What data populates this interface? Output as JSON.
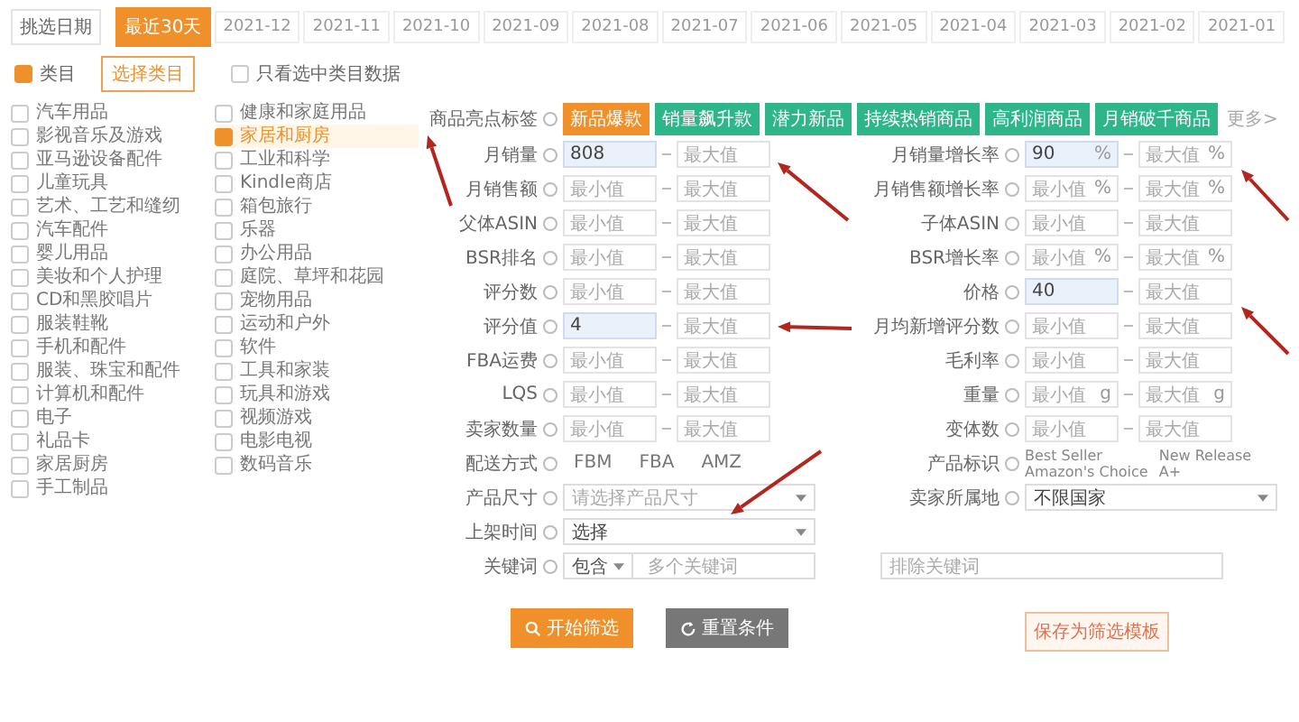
{
  "date_filter": {
    "label": "挑选日期",
    "options": [
      {
        "label": "最近30天",
        "selected": true
      },
      {
        "label": "2021-12",
        "selected": false
      },
      {
        "label": "2021-11",
        "selected": false
      },
      {
        "label": "2021-10",
        "selected": false
      },
      {
        "label": "2021-09",
        "selected": false
      },
      {
        "label": "2021-08",
        "selected": false
      },
      {
        "label": "2021-07",
        "selected": false
      },
      {
        "label": "2021-06",
        "selected": false
      },
      {
        "label": "2021-05",
        "selected": false
      },
      {
        "label": "2021-04",
        "selected": false
      },
      {
        "label": "2021-03",
        "selected": false
      },
      {
        "label": "2021-02",
        "selected": false
      },
      {
        "label": "2021-01",
        "selected": false
      }
    ]
  },
  "category_filter": {
    "checkbox": {
      "label": "类目",
      "checked": true
    },
    "button": "选择类目",
    "only_selected": {
      "label": "只看选中类目数据",
      "checked": false
    }
  },
  "category_columns": [
    {
      "items": [
        {
          "label": "汽车用品",
          "checked": false
        },
        {
          "label": "影视音乐及游戏",
          "checked": false
        },
        {
          "label": "亚马逊设备配件",
          "checked": false
        },
        {
          "label": "儿童玩具",
          "checked": false
        },
        {
          "label": "艺术、工艺和缝纫",
          "checked": false
        },
        {
          "label": "汽车配件",
          "checked": false
        },
        {
          "label": "婴儿用品",
          "checked": false
        },
        {
          "label": "美妆和个人护理",
          "checked": false
        },
        {
          "label": "CD和黑胶唱片",
          "checked": false
        },
        {
          "label": "服装鞋靴",
          "checked": false
        },
        {
          "label": "手机和配件",
          "checked": false
        },
        {
          "label": "服装、珠宝和配件",
          "checked": false
        },
        {
          "label": "计算机和配件",
          "checked": false
        },
        {
          "label": "电子",
          "checked": false
        },
        {
          "label": "礼品卡",
          "checked": false
        },
        {
          "label": "家居厨房",
          "checked": false
        },
        {
          "label": "手工制品",
          "checked": false
        }
      ]
    },
    {
      "items": [
        {
          "label": "健康和家庭用品",
          "checked": false
        },
        {
          "label": "家居和厨房",
          "checked": true
        },
        {
          "label": "工业和科学",
          "checked": false
        },
        {
          "label": "Kindle商店",
          "checked": false
        },
        {
          "label": "箱包旅行",
          "checked": false
        },
        {
          "label": "乐器",
          "checked": false
        },
        {
          "label": "办公用品",
          "checked": false
        },
        {
          "label": "庭院、草坪和花园",
          "checked": false
        },
        {
          "label": "宠物用品",
          "checked": false
        },
        {
          "label": "运动和户外",
          "checked": false
        },
        {
          "label": "软件",
          "checked": false
        },
        {
          "label": "工具和家装",
          "checked": false
        },
        {
          "label": "玩具和游戏",
          "checked": false
        },
        {
          "label": "视频游戏",
          "checked": false
        },
        {
          "label": "电影电视",
          "checked": false
        },
        {
          "label": "数码音乐",
          "checked": false
        }
      ]
    }
  ],
  "highlight_tags": {
    "label": "商品亮点标签",
    "tags": [
      {
        "label": "新品爆款",
        "selected": true
      },
      {
        "label": "销量飙升款",
        "selected": false
      },
      {
        "label": "潜力新品",
        "selected": false
      },
      {
        "label": "持续热销商品",
        "selected": false
      },
      {
        "label": "高利润商品",
        "selected": false
      },
      {
        "label": "月销破千商品",
        "selected": false
      }
    ],
    "more": "更多>"
  },
  "range_rows": [
    [
      {
        "label": "月销量",
        "min": {
          "value": "808"
        },
        "max": {
          "placeholder": "最大值"
        }
      },
      {
        "label": "月销量增长率",
        "min": {
          "value": "90",
          "unit": "%"
        },
        "max": {
          "placeholder": "最大值",
          "unit": "%"
        }
      }
    ],
    [
      {
        "label": "月销售额",
        "min": {
          "placeholder": "最小值"
        },
        "max": {
          "placeholder": "最大值"
        }
      },
      {
        "label": "月销售额增长率",
        "min": {
          "placeholder": "最小值",
          "unit": "%"
        },
        "max": {
          "placeholder": "最大值",
          "unit": "%"
        }
      }
    ],
    [
      {
        "label": "父体ASIN",
        "min": {
          "placeholder": "最小值"
        },
        "max": {
          "placeholder": "最大值"
        }
      },
      {
        "label": "子体ASIN",
        "min": {
          "placeholder": "最小值"
        },
        "max": {
          "placeholder": "最大值"
        }
      }
    ],
    [
      {
        "label": "BSR排名",
        "min": {
          "placeholder": "最小值"
        },
        "max": {
          "placeholder": "最大值"
        }
      },
      {
        "label": "BSR增长率",
        "min": {
          "placeholder": "最小值",
          "unit": "%"
        },
        "max": {
          "placeholder": "最大值",
          "unit": "%"
        }
      }
    ],
    [
      {
        "label": "评分数",
        "min": {
          "placeholder": "最小值"
        },
        "max": {
          "placeholder": "最大值"
        }
      },
      {
        "label": "价格",
        "min": {
          "value": "40"
        },
        "max": {
          "placeholder": "最大值"
        }
      }
    ],
    [
      {
        "label": "评分值",
        "min": {
          "value": "4"
        },
        "max": {
          "placeholder": "最大值"
        }
      },
      {
        "label": "月均新增评分数",
        "min": {
          "placeholder": "最小值"
        },
        "max": {
          "placeholder": "最大值"
        }
      }
    ],
    [
      {
        "label": "FBA运费",
        "min": {
          "placeholder": "最小值"
        },
        "max": {
          "placeholder": "最大值"
        }
      },
      {
        "label": "毛利率",
        "min": {
          "placeholder": "最小值"
        },
        "max": {
          "placeholder": "最大值"
        }
      }
    ],
    [
      {
        "label": "LQS",
        "min": {
          "placeholder": "最小值"
        },
        "max": {
          "placeholder": "最大值"
        }
      },
      {
        "label": "重量",
        "min": {
          "placeholder": "最小值",
          "unit": "g"
        },
        "max": {
          "placeholder": "最大值",
          "unit": "g"
        }
      }
    ],
    [
      {
        "label": "卖家数量",
        "min": {
          "placeholder": "最小值"
        },
        "max": {
          "placeholder": "最大值"
        }
      },
      {
        "label": "变体数",
        "min": {
          "placeholder": "最小值"
        },
        "max": {
          "placeholder": "最大值"
        }
      }
    ]
  ],
  "shipping": {
    "label": "配送方式",
    "options": [
      "FBM",
      "FBA",
      "AMZ"
    ]
  },
  "badges": {
    "label": "产品标识",
    "options": [
      "Best Seller",
      "New Release",
      "Amazon's Choice",
      "A+"
    ]
  },
  "selects": [
    [
      {
        "label": "产品尺寸",
        "placeholder": "请选择产品尺寸"
      },
      {
        "label": "卖家所属地",
        "value": "不限国家"
      }
    ],
    [
      {
        "label": "上架时间",
        "value": "选择"
      }
    ]
  ],
  "keywords": {
    "label": "关键词",
    "mode": "包含",
    "placeholder": "多个关键词",
    "exclude_placeholder": "排除关键词"
  },
  "buttons": {
    "search": "开始筛选",
    "reset": "重置条件",
    "save": "保存为筛选模板"
  }
}
